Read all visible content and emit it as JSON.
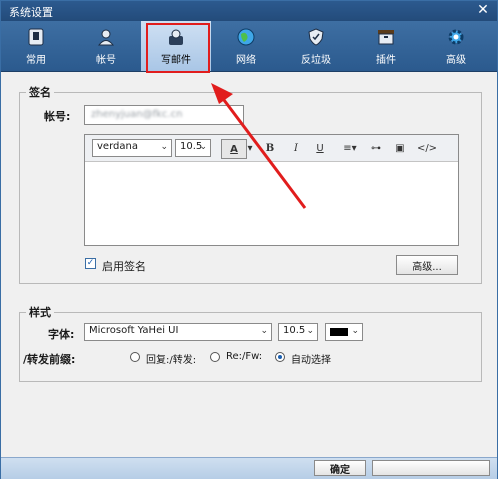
{
  "window": {
    "title": "系统设置",
    "close": "✕"
  },
  "tabs": [
    {
      "label": "常用",
      "icon": "doc-icon"
    },
    {
      "label": "帐号",
      "icon": "user-icon"
    },
    {
      "label": "写邮件",
      "icon": "compose-icon"
    },
    {
      "label": "网络",
      "icon": "globe-icon"
    },
    {
      "label": "反垃圾",
      "icon": "shield-icon"
    },
    {
      "label": "插件",
      "icon": "box-icon"
    },
    {
      "label": "高级",
      "icon": "gear-icon"
    }
  ],
  "signature": {
    "legend": "签名",
    "account_label": "帐号:",
    "account_value": "zhenyjuan@fkc.cn",
    "font_name": "verdana",
    "font_size": "10.5",
    "enable_label": "启用签名",
    "advanced_button": "高级..."
  },
  "style": {
    "legend": "样式",
    "font_label": "字体:",
    "font_value": "Microsoft YaHei UI",
    "size_value": "10.5",
    "prefix_label": "/转发前缀:",
    "option1": "回复:/转发:",
    "option2": "Re:/Fw:",
    "option3": "自动选择"
  },
  "footer": {
    "ok": "确定",
    "cancel": ""
  },
  "colors": {
    "toolbar": "#2b5a8e",
    "highlight": "#e11d1d",
    "accent": "#1b5fb0"
  }
}
